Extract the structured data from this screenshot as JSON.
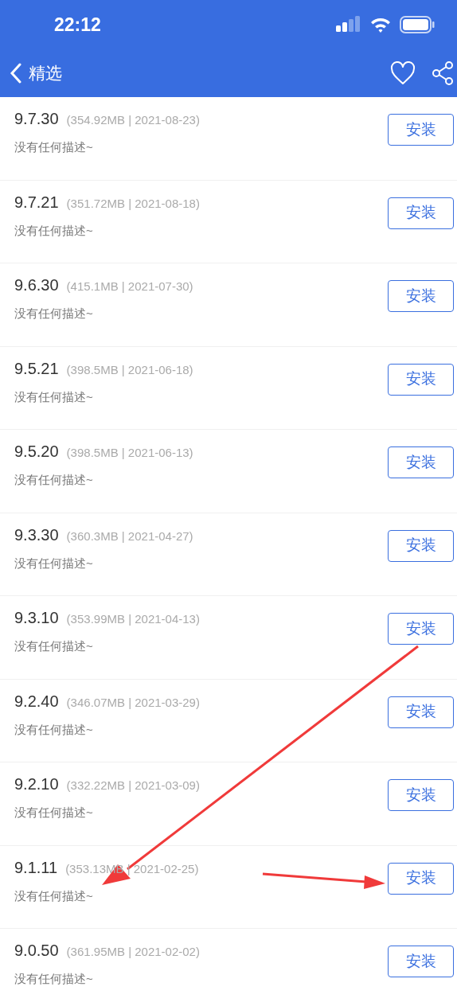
{
  "status_bar": {
    "time": "22:12"
  },
  "nav": {
    "back_label": "精选"
  },
  "versions": [
    {
      "version": "9.7.30",
      "meta": "(354.92MB | 2021-08-23)",
      "description": "没有任何描述~",
      "button": "安装"
    },
    {
      "version": "9.7.21",
      "meta": "(351.72MB | 2021-08-18)",
      "description": "没有任何描述~",
      "button": "安装"
    },
    {
      "version": "9.6.30",
      "meta": "(415.1MB | 2021-07-30)",
      "description": "没有任何描述~",
      "button": "安装"
    },
    {
      "version": "9.5.21",
      "meta": "(398.5MB | 2021-06-18)",
      "description": "没有任何描述~",
      "button": "安装"
    },
    {
      "version": "9.5.20",
      "meta": "(398.5MB | 2021-06-13)",
      "description": "没有任何描述~",
      "button": "安装"
    },
    {
      "version": "9.3.30",
      "meta": "(360.3MB | 2021-04-27)",
      "description": "没有任何描述~",
      "button": "安装"
    },
    {
      "version": "9.3.10",
      "meta": "(353.99MB | 2021-04-13)",
      "description": "没有任何描述~",
      "button": "安装"
    },
    {
      "version": "9.2.40",
      "meta": "(346.07MB | 2021-03-29)",
      "description": "没有任何描述~",
      "button": "安装"
    },
    {
      "version": "9.2.10",
      "meta": "(332.22MB | 2021-03-09)",
      "description": "没有任何描述~",
      "button": "安装"
    },
    {
      "version": "9.1.11",
      "meta": "(353.13MB | 2021-02-25)",
      "description": "没有任何描述~",
      "button": "安装"
    },
    {
      "version": "9.0.50",
      "meta": "(361.95MB | 2021-02-02)",
      "description": "没有任何描述~",
      "button": "安装"
    }
  ]
}
